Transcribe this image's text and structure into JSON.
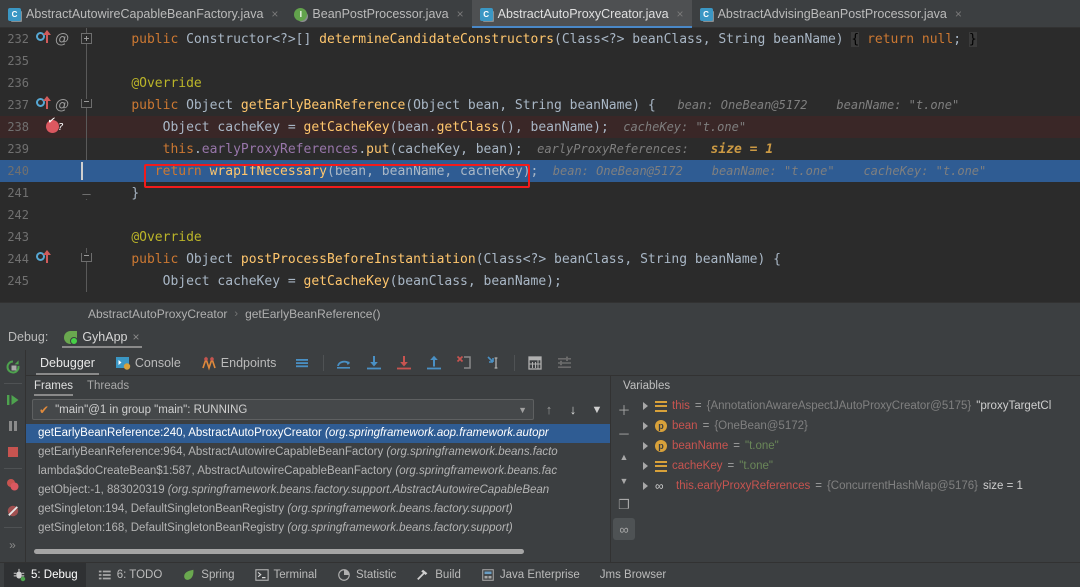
{
  "tabs": [
    {
      "label": "AbstractAutowireCapableBeanFactory.java",
      "icon": "java-class-icon",
      "active": false,
      "close": "×"
    },
    {
      "label": "BeanPostProcessor.java",
      "icon": "java-interface-icon",
      "active": false,
      "close": "×"
    },
    {
      "label": "AbstractAutoProxyCreator.java",
      "icon": "java-class-icon",
      "active": true,
      "close": "×"
    },
    {
      "label": "AbstractAdvisingBeanPostProcessor.java",
      "icon": "java-class-icon",
      "active": false,
      "close": "×"
    }
  ],
  "editor": {
    "lines": [
      {
        "num": "232",
        "gutter": [
          "override-method-icon",
          "at-icon"
        ],
        "fold": "plus",
        "state": "normal"
      },
      {
        "num": "235",
        "gutter": [],
        "fold": "none",
        "state": "normal"
      },
      {
        "num": "236",
        "gutter": [],
        "fold": "none",
        "state": "normal"
      },
      {
        "num": "237",
        "gutter": [
          "override-method-icon",
          "at-icon"
        ],
        "fold": "end",
        "state": "normal"
      },
      {
        "num": "238",
        "gutter": [
          "breakpoint-verified-icon",
          "conditional-question-icon"
        ],
        "fold": "none",
        "state": "breakpoint"
      },
      {
        "num": "239",
        "gutter": [],
        "fold": "none",
        "state": "normal"
      },
      {
        "num": "240",
        "gutter": [],
        "fold": "none",
        "state": "executing"
      },
      {
        "num": "241",
        "gutter": [],
        "fold": "endline",
        "state": "normal"
      },
      {
        "num": "242",
        "gutter": [],
        "fold": "none",
        "state": "normal"
      },
      {
        "num": "243",
        "gutter": [],
        "fold": "none",
        "state": "normal"
      },
      {
        "num": "244",
        "gutter": [
          "override-method-icon"
        ],
        "fold": "end",
        "state": "normal"
      },
      {
        "num": "245",
        "gutter": [],
        "fold": "none",
        "state": "normal"
      }
    ],
    "code": {
      "l232": "public Constructor<?>[] determineCandidateConstructors(Class<?> beanClass, String beanName) { return null; }",
      "l236_annotation": "@Override",
      "l237": "public Object getEarlyBeanReference(Object bean, String beanName) {",
      "l237_hint": "bean: OneBean@5172    beanName: \"t.one\"",
      "l238": "Object cacheKey = getCacheKey(bean.getClass(), beanName);",
      "l238_hint": "cacheKey: \"t.one\"",
      "l239": "this.earlyProxyReferences.put(cacheKey, bean);",
      "l239_hint_label": "earlyProxyReferences:",
      "l239_hint_value": "size = 1",
      "l240": "return wrapIfNecessary(bean, beanName, cacheKey);",
      "l240_hint": "bean: OneBean@5172    beanName: \"t.one\"    cacheKey: \"t.one\"",
      "l241": "}",
      "l243_annotation": "@Override",
      "l244": "public Object postProcessBeforeInstantiation(Class<?> beanClass, String beanName) {",
      "l245": "Object cacheKey = getCacheKey(beanClass, beanName);"
    }
  },
  "breadcrumb": {
    "class": "AbstractAutoProxyCreator",
    "separator": "›",
    "method": "getEarlyBeanReference()"
  },
  "debug_header": {
    "label": "Debug:",
    "config_name": "GyhApp",
    "close": "×",
    "icon": "spring-boot-run-icon"
  },
  "debug_sidebar": [
    {
      "name": "rerun-button",
      "icon": "rerun-icon"
    },
    {
      "name": "resume-button",
      "icon": "resume-play-icon"
    },
    {
      "name": "pause-button",
      "icon": "pause-icon"
    },
    {
      "name": "stop-button",
      "icon": "stop-square-icon"
    },
    {
      "name": "view-breakpoints-button",
      "icon": "breakpoints-icon"
    },
    {
      "name": "mute-breakpoints-button",
      "icon": "mute-breakpoints-icon"
    },
    {
      "name": "expand-button",
      "icon": "chevrons-right-icon"
    }
  ],
  "debug_toolbar": {
    "tabs": [
      {
        "label": "Debugger",
        "icon": "",
        "active": true
      },
      {
        "label": "Console",
        "icon": "console-icon",
        "active": false
      },
      {
        "label": "Endpoints",
        "icon": "endpoints-icon",
        "active": false
      }
    ],
    "actions": [
      {
        "name": "layout-settings-button",
        "icon": "lines-icon"
      },
      {
        "name": "step-over-button",
        "icon": "step-over-icon"
      },
      {
        "name": "step-into-button",
        "icon": "step-into-icon"
      },
      {
        "name": "force-step-into-button",
        "icon": "force-step-into-icon"
      },
      {
        "name": "step-out-button",
        "icon": "step-out-icon"
      },
      {
        "name": "drop-frame-button",
        "icon": "drop-frame-icon"
      },
      {
        "name": "run-to-cursor-button",
        "icon": "run-to-cursor-icon"
      },
      {
        "name": "evaluate-expression-button",
        "icon": "calculator-icon"
      },
      {
        "name": "settings-button",
        "icon": "settings-sliders-icon"
      }
    ]
  },
  "frames_panel": {
    "sub_tabs": [
      {
        "label": "Frames",
        "active": true
      },
      {
        "label": "Threads",
        "active": false
      }
    ],
    "thread_selector": {
      "value": "\"main\"@1 in group \"main\": RUNNING",
      "check": "✔",
      "arrow": "▼"
    },
    "thread_actions": [
      {
        "name": "frame-up-button",
        "icon": "arrow-up-icon",
        "glyph": "↑"
      },
      {
        "name": "frame-down-button",
        "icon": "arrow-down-icon",
        "glyph": "↓"
      },
      {
        "name": "filter-frames-button",
        "icon": "funnel-icon",
        "glyph": "▼"
      }
    ],
    "frames": [
      {
        "method": "getEarlyBeanReference:240, AbstractAutoProxyCreator ",
        "pkg": "(org.springframework.aop.framework.autopr",
        "selected": true
      },
      {
        "method": "getEarlyBeanReference:964, AbstractAutowireCapableBeanFactory ",
        "pkg": "(org.springframework.beans.facto",
        "selected": false
      },
      {
        "method": "lambda$doCreateBean$1:587, AbstractAutowireCapableBeanFactory ",
        "pkg": "(org.springframework.beans.fac",
        "selected": false
      },
      {
        "method": "getObject:-1, 883020319 ",
        "pkg": "(org.springframework.beans.factory.support.AbstractAutowireCapableBean",
        "selected": false
      },
      {
        "method": "getSingleton:194, DefaultSingletonBeanRegistry ",
        "pkg": "(org.springframework.beans.factory.support)",
        "selected": false
      },
      {
        "method": "getSingleton:168, DefaultSingletonBeanRegistry ",
        "pkg": "(org.springframework.beans.factory.support)",
        "selected": false
      }
    ]
  },
  "variables_panel": {
    "title": "Variables",
    "rows": [
      {
        "icon": "list-field-icon",
        "name": "this",
        "eq": "=",
        "obj": "{AnnotationAwareAspectJAutoProxyCreator@5175}",
        "extra": "\"proxyTargetCl",
        "extra_kind": "string"
      },
      {
        "icon": "parameter-icon",
        "name": "bean",
        "eq": "=",
        "obj": "{OneBean@5172}",
        "extra": "",
        "extra_kind": "none"
      },
      {
        "icon": "parameter-icon",
        "name": "beanName",
        "eq": "=",
        "obj": "",
        "extra": "\"t.one\"",
        "extra_kind": "string"
      },
      {
        "icon": "list-field-icon",
        "name": "cacheKey",
        "eq": "=",
        "obj": "",
        "extra": "\"t.one\"",
        "extra_kind": "string"
      },
      {
        "icon": "watch-icon",
        "name": "this.earlyProxyReferences",
        "eq": "=",
        "obj": "{ConcurrentHashMap@5176}",
        "extra": "size = 1",
        "extra_kind": "size"
      }
    ],
    "rail": [
      {
        "name": "add-watch-button",
        "glyph": "＋",
        "icon": "plus-icon",
        "active": false
      },
      {
        "name": "remove-watch-button",
        "glyph": "－",
        "icon": "minus-icon",
        "active": false
      },
      {
        "name": "move-watch-up-button",
        "glyph": "▲",
        "icon": "triangle-up-icon",
        "active": false
      },
      {
        "name": "move-watch-down-button",
        "glyph": "▼",
        "icon": "triangle-down-icon",
        "active": false
      },
      {
        "name": "copy-value-button",
        "glyph": "❐",
        "icon": "copy-icon",
        "active": false
      },
      {
        "name": "toggle-watches-button",
        "glyph": "∞",
        "icon": "watches-icon",
        "active": true
      }
    ]
  },
  "statusbar": [
    {
      "label": "5: Debug",
      "accesskey": "5",
      "icon": "debug-icon",
      "active": true
    },
    {
      "label": "6: TODO",
      "accesskey": "6",
      "icon": "todo-list-icon",
      "active": false
    },
    {
      "label": "Spring",
      "accesskey": "",
      "icon": "spring-leaf-icon",
      "active": false
    },
    {
      "label": "Terminal",
      "accesskey": "",
      "icon": "terminal-icon",
      "active": false
    },
    {
      "label": "Statistic",
      "accesskey": "",
      "icon": "pie-chart-icon",
      "active": false
    },
    {
      "label": "Build",
      "accesskey": "",
      "icon": "hammer-icon",
      "active": false
    },
    {
      "label": "Java Enterprise",
      "accesskey": "",
      "icon": "java-enterprise-icon",
      "active": false
    },
    {
      "label": "Jms Browser",
      "accesskey": "",
      "icon": "",
      "active": false
    }
  ],
  "colors": {
    "accent_blue": "#2f5c93",
    "breakpoint_red": "#db5860",
    "highlight_box": "#f21b1b",
    "keyword_orange": "#cc7832",
    "method_yellow": "#ffc66d",
    "string_green": "#6a8759"
  }
}
